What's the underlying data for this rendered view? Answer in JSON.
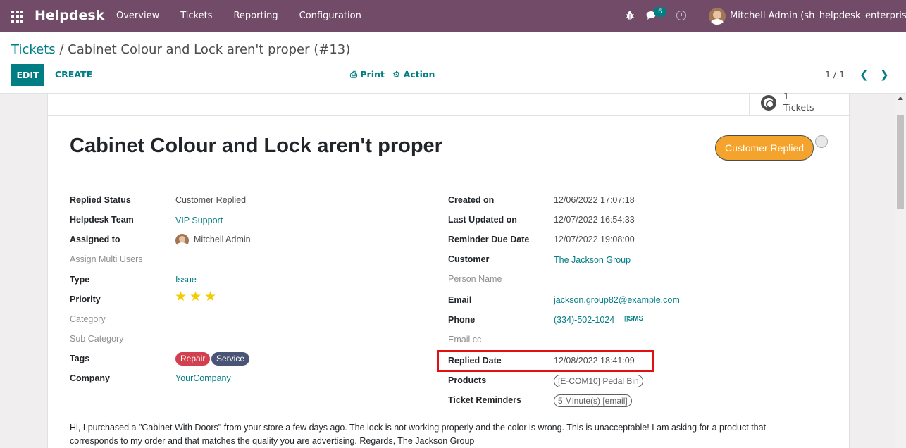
{
  "navbar": {
    "app_name": "Helpdesk",
    "menu": [
      "Overview",
      "Tickets",
      "Reporting",
      "Configuration"
    ],
    "chat_count": "6",
    "user_name": "Mitchell Admin (sh_helpdesk_enterprise)",
    "color": "#714b67"
  },
  "control": {
    "breadcrumb_parent": "Tickets",
    "breadcrumb_current": " / Cabinet Colour and Lock aren't proper (#13)",
    "edit_label": "EDIT",
    "create_label": "CREATE",
    "print_label": "Print",
    "action_label": "Action",
    "pager": "1 / 1",
    "accent": "#017e84"
  },
  "smart_button": {
    "value": "1",
    "label": "Tickets"
  },
  "ticket": {
    "title": "Cabinet Colour and Lock aren't proper",
    "status": "Customer Replied",
    "status_color": "#f4a42d",
    "priority_stars": 3,
    "description": "Hi, I purchased a \"Cabinet With Doors\" from your store a few days ago. The lock is not working properly and the color is wrong. This is unacceptable! I am asking for a product that corresponds to my order and that matches the quality you are advertising. Regards, The Jackson Group"
  },
  "left_fields": {
    "replied_status_label": "Replied Status",
    "replied_status": "Customer Replied",
    "team_label": "Helpdesk Team",
    "team": "VIP Support",
    "assigned_label": "Assigned to",
    "assigned": "Mitchell Admin",
    "multi_users_label": "Assign Multi Users",
    "type_label": "Type",
    "type": "Issue",
    "priority_label": "Priority",
    "category_label": "Category",
    "sub_category_label": "Sub Category",
    "tags_label": "Tags",
    "tags": [
      "Repair",
      "Service"
    ],
    "company_label": "Company",
    "company": "YourCompany"
  },
  "right_fields": {
    "created_label": "Created on",
    "created": "12/06/2022 17:07:18",
    "updated_label": "Last Updated on",
    "updated": "12/07/2022 16:54:33",
    "reminder_due_label": "Reminder Due Date",
    "reminder_due": "12/07/2022 19:08:00",
    "customer_label": "Customer",
    "customer": "The Jackson Group",
    "person_label": "Person Name",
    "email_label": "Email",
    "email": "jackson.group82@example.com",
    "phone_label": "Phone",
    "phone": "(334)-502-1024",
    "sms_label": "SMS",
    "email_cc_label": "Email cc",
    "replied_date_label": "Replied Date",
    "replied_date": "12/08/2022 18:41:09",
    "products_label": "Products",
    "products": "[E-COM10] Pedal Bin",
    "reminders_label": "Ticket Reminders",
    "reminders": "5 Minute(s) [email]"
  }
}
